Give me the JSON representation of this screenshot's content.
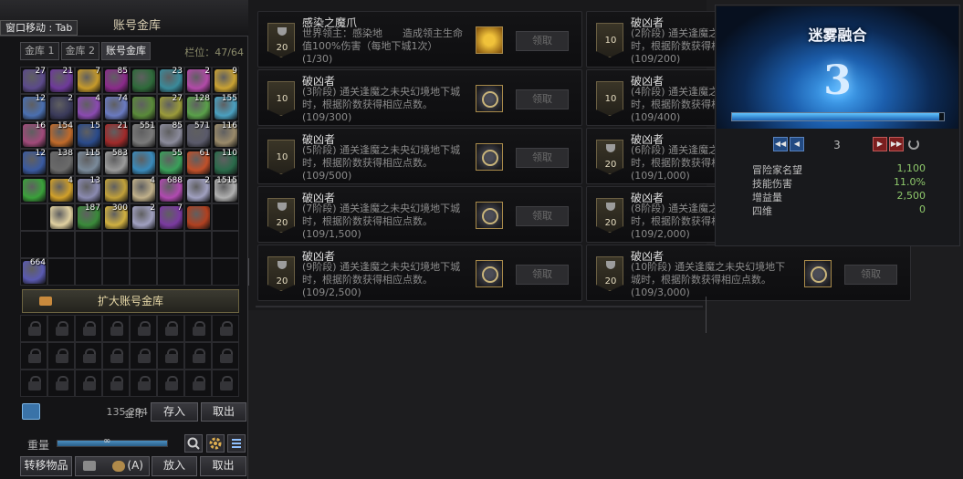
{
  "storage": {
    "title": "账号金库",
    "move_hint": "窗口移动 : Tab",
    "tabs": [
      "金库 1",
      "金库 2",
      "账号金库"
    ],
    "slots_label": "栏位：47/64",
    "items": [
      {
        "count": "27",
        "color": "#5b4a8a"
      },
      {
        "count": "21",
        "color": "#6e3a9a"
      },
      {
        "count": "7",
        "color": "#c69a2a"
      },
      {
        "count": "85",
        "color": "#8a2a8a"
      },
      {
        "count": "",
        "color": "#2e6a3a"
      },
      {
        "count": "23",
        "color": "#3a8a9a"
      },
      {
        "count": "2",
        "color": "#b24aa8"
      },
      {
        "count": "9",
        "color": "#c9a233"
      },
      {
        "count": "12",
        "color": "#4a6fb0"
      },
      {
        "count": "2",
        "color": "#3a3a5a"
      },
      {
        "count": "4",
        "color": "#8a4ab0"
      },
      {
        "count": "74",
        "color": "#6a7ac0"
      },
      {
        "count": "",
        "color": "#5a8a3a"
      },
      {
        "count": "27",
        "color": "#9a9a3a"
      },
      {
        "count": "128",
        "color": "#5aa04a"
      },
      {
        "count": "155",
        "color": "#4aa0c0"
      },
      {
        "count": "16",
        "color": "#a04a7a"
      },
      {
        "count": "154",
        "color": "#c06a2a"
      },
      {
        "count": "15",
        "color": "#2a4a8a"
      },
      {
        "count": "21",
        "color": "#a02a2a"
      },
      {
        "count": "551",
        "color": "#7a7a7a"
      },
      {
        "count": "85",
        "color": "#8a8a9a"
      },
      {
        "count": "571",
        "color": "#5a5a6a"
      },
      {
        "count": "116",
        "color": "#9a8a6a"
      },
      {
        "count": "12",
        "color": "#3a5aa0"
      },
      {
        "count": "138",
        "color": "#6a6a6a"
      },
      {
        "count": "115",
        "color": "#7a8a9a"
      },
      {
        "count": "583",
        "color": "#9a9a9a"
      },
      {
        "count": "",
        "color": "#3a8aba"
      },
      {
        "count": "55",
        "color": "#3aa05a"
      },
      {
        "count": "61",
        "color": "#c0502a"
      },
      {
        "count": "110",
        "color": "#2a6a4a"
      },
      {
        "count": "",
        "color": "#3aa03a"
      },
      {
        "count": "4",
        "color": "#d0a02a"
      },
      {
        "count": "13",
        "color": "#8a8ab0"
      },
      {
        "count": "",
        "color": "#c0a03a"
      },
      {
        "count": "4",
        "color": "#c0b08a"
      },
      {
        "count": "688",
        "color": "#b04ab0"
      },
      {
        "count": "2",
        "color": "#a0a0c0"
      },
      {
        "count": "1515",
        "color": "#b0b0b0"
      },
      {
        "count": "",
        "color": "#0f0f11"
      },
      {
        "count": "",
        "color": "#e0d0a0"
      },
      {
        "count": "187",
        "color": "#3a8a3a"
      },
      {
        "count": "300",
        "color": "#d0b040"
      },
      {
        "count": "2",
        "color": "#a0a0c0"
      },
      {
        "count": "7",
        "color": "#7a3aa0"
      },
      {
        "count": "",
        "color": "#b04020"
      },
      {
        "count": "",
        "color": "#0f0f11"
      },
      {
        "count": "",
        "color": "#0f0f11"
      },
      {
        "count": "",
        "color": "#0f0f11"
      },
      {
        "count": "",
        "color": "#0f0f11"
      },
      {
        "count": "",
        "color": "#0f0f11"
      },
      {
        "count": "",
        "color": "#0f0f11"
      },
      {
        "count": "",
        "color": "#0f0f11"
      },
      {
        "count": "",
        "color": "#0f0f11"
      },
      {
        "count": "",
        "color": "#0f0f11"
      },
      {
        "count": "664",
        "color": "#5a5ab0"
      },
      {
        "count": "",
        "color": "#0f0f11"
      },
      {
        "count": "",
        "color": "#0f0f11"
      },
      {
        "count": "",
        "color": "#0f0f11"
      },
      {
        "count": "",
        "color": "#0f0f11"
      },
      {
        "count": "",
        "color": "#0f0f11"
      },
      {
        "count": "",
        "color": "#0f0f11"
      },
      {
        "count": "",
        "color": "#0f0f11"
      }
    ],
    "expand_label": "扩大账号金库",
    "locked_slots": 24,
    "gold_amount": "135,294",
    "gold_label": "金币",
    "deposit_label": "存入",
    "withdraw_label": "取出",
    "weight_label": "重量",
    "weight_value": "∞",
    "weight_fill": 1.0,
    "transfer_label": "转移物品",
    "exchange_label": "← (A)",
    "put_label": "放入",
    "take_label": "取出"
  },
  "rewards": {
    "claim_label": "领取",
    "cards": [
      {
        "title": "感染之魔爪",
        "desc": "世界领主：感染地　　造成领主生命值100%伤害（每地下城1次）",
        "progress": "(1/30)",
        "badge": "20",
        "trophy": true,
        "icon": "star"
      },
      {
        "title": "破凶者",
        "desc": "(2阶段) 通关逢魔之未央幻境地下城时，根据阶数获得相应点数。",
        "progress": "(109/200)",
        "badge": "10",
        "trophy": false,
        "icon": "emblem"
      },
      {
        "title": "破凶者",
        "desc": "(3阶段) 通关逢魔之未央幻境地下城时，根据阶数获得相应点数。",
        "progress": "(109/300)",
        "badge": "10",
        "trophy": false,
        "icon": "emblem"
      },
      {
        "title": "破凶者",
        "desc": "(4阶段) 通关逢魔之未央幻境地下城时，根据阶数获得相应点数。",
        "progress": "(109/400)",
        "badge": "10",
        "trophy": false,
        "icon": "emblem"
      },
      {
        "title": "破凶者",
        "desc": "(5阶段) 通关逢魔之未央幻境地下城时，根据阶数获得相应点数。",
        "progress": "(109/500)",
        "badge": "10",
        "trophy": false,
        "icon": "emblem"
      },
      {
        "title": "破凶者",
        "desc": "(6阶段) 通关逢魔之未央幻境地下城时，根据阶数获得相应点数。",
        "progress": "(109/1,000)",
        "badge": "20",
        "trophy": true,
        "icon": "emblem"
      },
      {
        "title": "破凶者",
        "desc": "(7阶段) 通关逢魔之未央幻境地下城时，根据阶数获得相应点数。",
        "progress": "(109/1,500)",
        "badge": "20",
        "trophy": true,
        "icon": "emblem"
      },
      {
        "title": "破凶者",
        "desc": "(8阶段) 通关逢魔之未央幻境地下城时，根据阶数获得相应点数。",
        "progress": "(109/2,000)",
        "badge": "20",
        "trophy": true,
        "icon": "emblem"
      },
      {
        "title": "破凶者",
        "desc": "(9阶段) 通关逢魔之未央幻境地下城时，根据阶数获得相应点数。",
        "progress": "(109/2,500)",
        "badge": "20",
        "trophy": true,
        "icon": "emblem"
      },
      {
        "title": "破凶者",
        "desc": "(10阶段) 通关逢魔之未央幻境地下城时，根据阶数获得相应点数。",
        "progress": "(109/3,000)",
        "badge": "20",
        "trophy": true,
        "icon": "emblem"
      }
    ]
  },
  "fusion": {
    "title": "迷雾融合",
    "level": "3",
    "progress_fill": 0.98,
    "page": "3",
    "stats": [
      {
        "label": "冒险家名望",
        "value": "1,100"
      },
      {
        "label": "技能伤害",
        "value": "11.0%"
      },
      {
        "label": "增益量",
        "value": "2,500"
      },
      {
        "label": "四维",
        "value": "0"
      }
    ]
  }
}
